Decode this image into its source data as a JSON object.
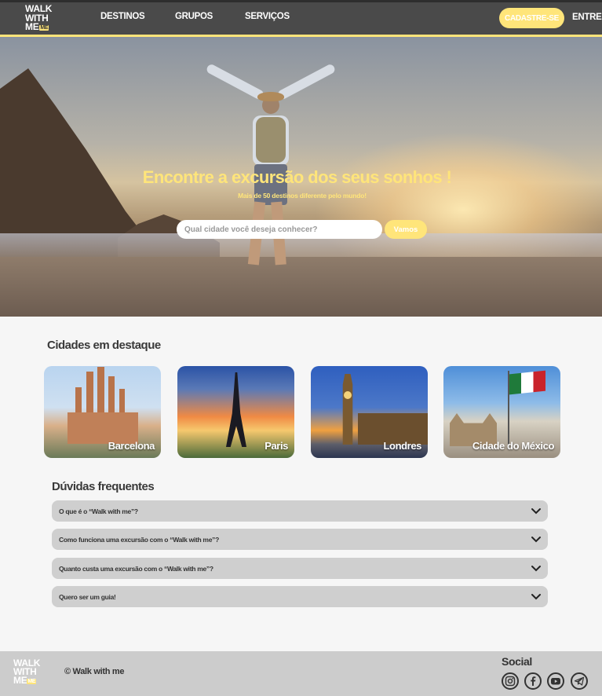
{
  "nav": {
    "logo_line1": "WALK",
    "logo_line2": "WITH",
    "logo_line3": "ME",
    "logo_badge": "ME",
    "links": [
      "DESTINOS",
      "GRUPOS",
      "SERVIÇOS"
    ],
    "signup": "CADASTRE-SE",
    "login": "ENTRE"
  },
  "hero": {
    "title": "Encontre a excursão dos seus sonhos !",
    "subtitle": "Mais de 50 destinos diferente pelo mundo!",
    "search_placeholder": "Qual cidade você deseja conhecer?",
    "search_button": "Vamos"
  },
  "cities": {
    "title": "Cidades em destaque",
    "items": [
      "Barcelona",
      "Paris",
      "Londres",
      "Cidade do México"
    ]
  },
  "faq": {
    "title": "Dúvidas frequentes",
    "items": [
      "O que é o “Walk with me”?",
      "Como funciona uma excursão com o “Walk with me”?",
      "Quanto custa uma excursão com o “Walk with me”?",
      "Quero ser um guia!"
    ]
  },
  "footer": {
    "copyright": "© Walk with me",
    "social_title": "Social",
    "social_icons": [
      "instagram-icon",
      "facebook-icon",
      "youtube-icon",
      "telegram-icon"
    ]
  },
  "colors": {
    "accent": "#ffe57a",
    "nav_bg": "#4a4a4a",
    "faq_bg": "#cfcfcf",
    "footer_bg": "#cccccc"
  }
}
